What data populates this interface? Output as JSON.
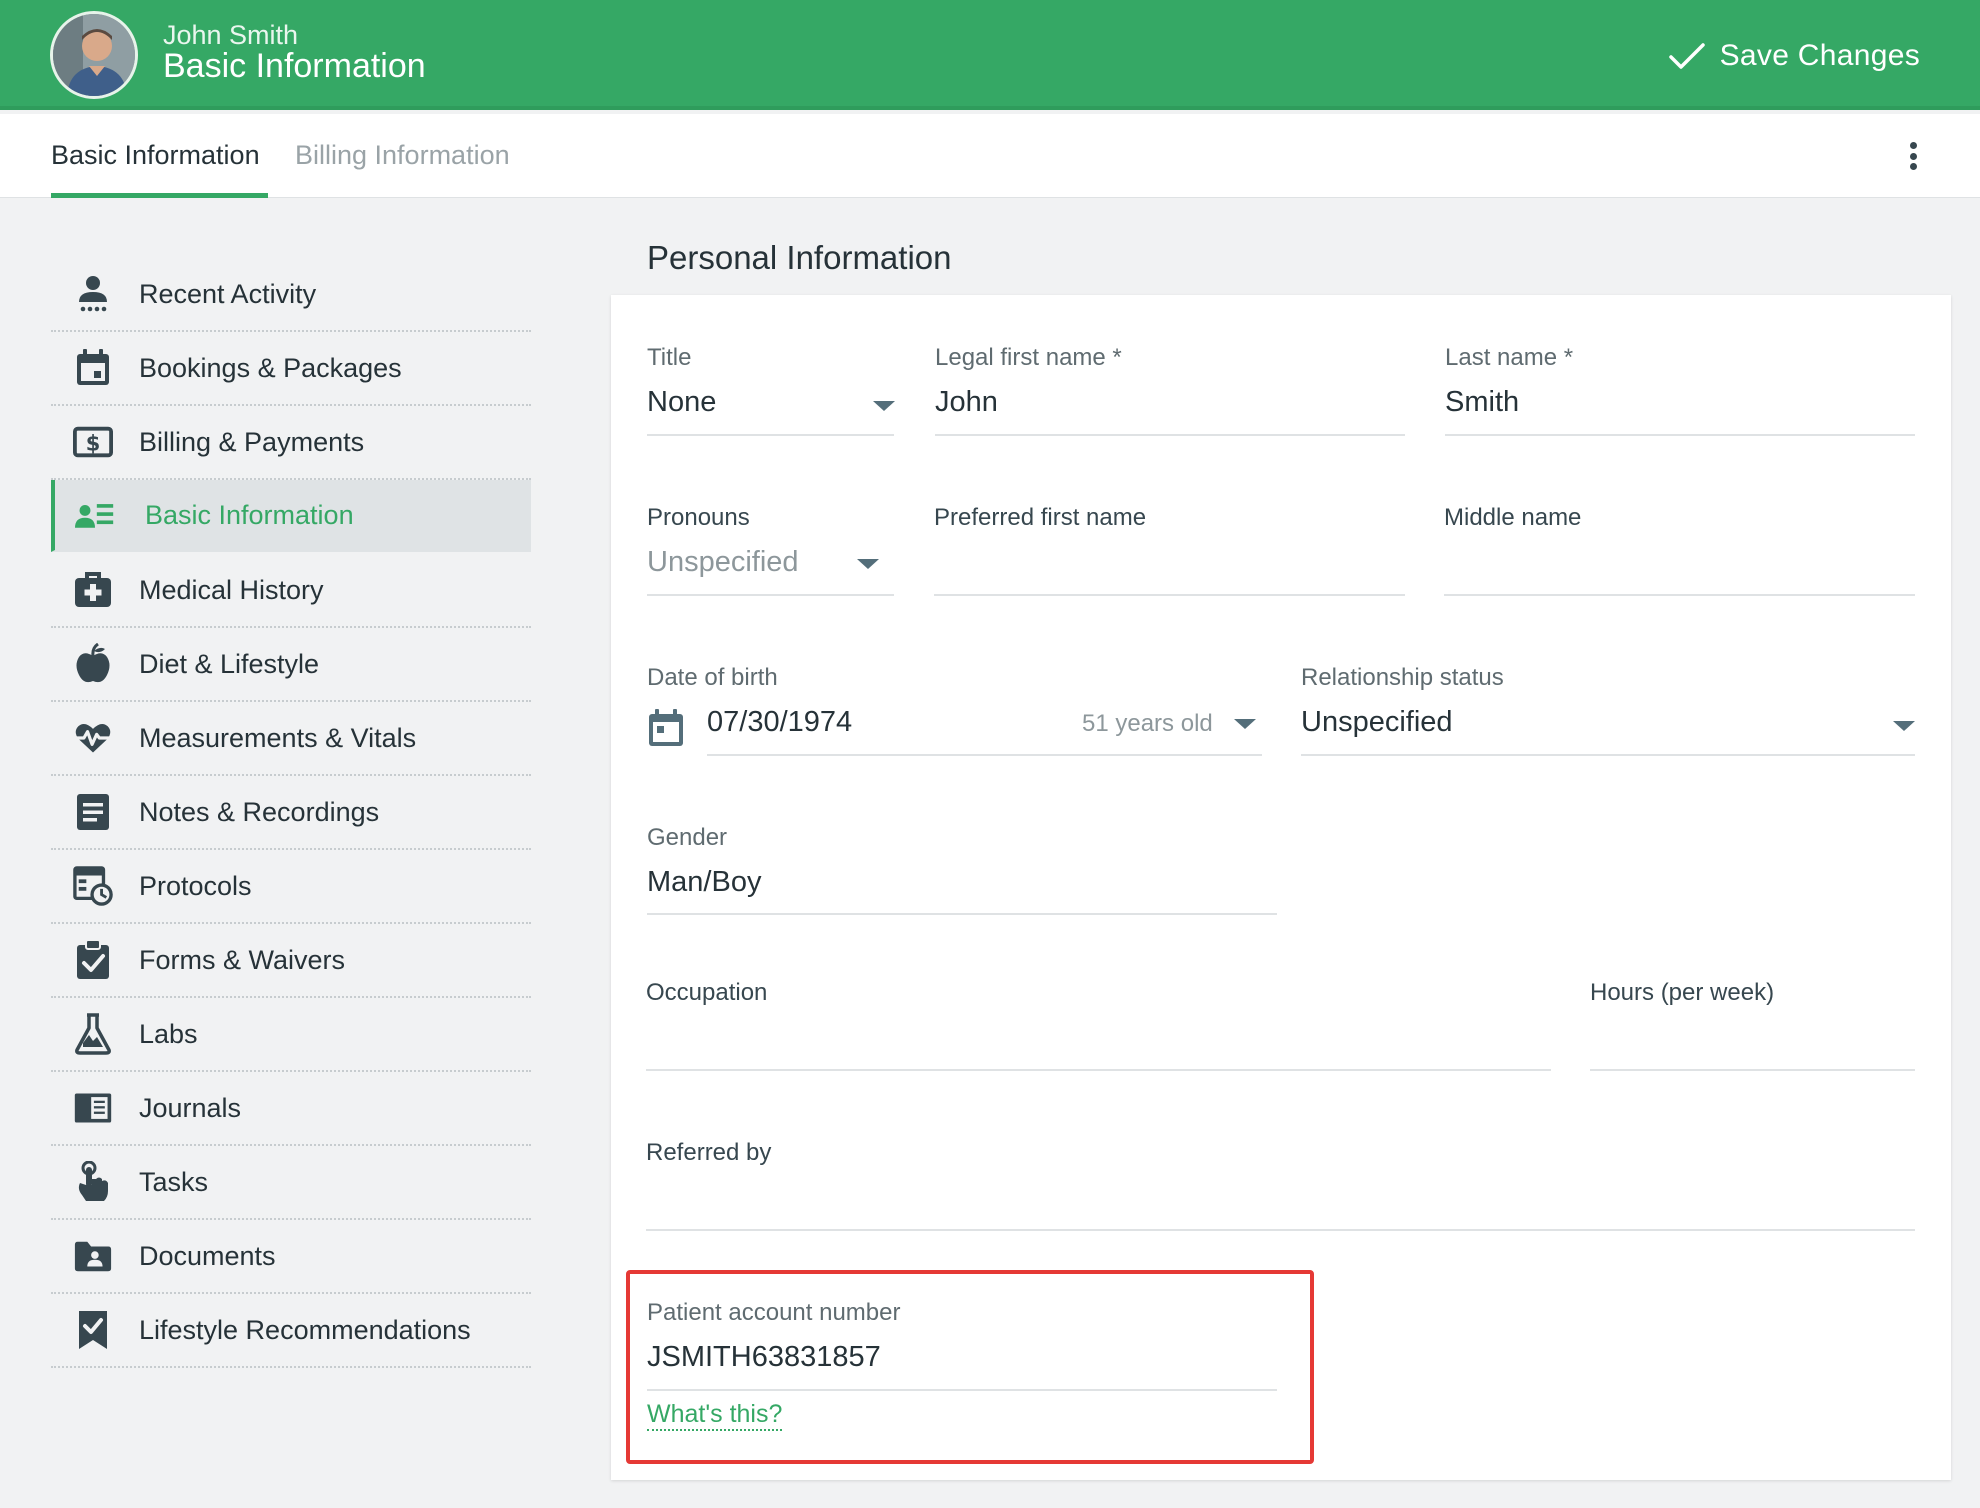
{
  "header": {
    "patient_name": "John Smith",
    "page_title": "Basic Information",
    "save_label": "Save Changes"
  },
  "tabs": [
    {
      "label": "Basic Information",
      "active": true
    },
    {
      "label": "Billing Information",
      "active": false
    }
  ],
  "sidebar": {
    "items": [
      {
        "label": "Recent Activity",
        "icon": "person-activity-icon"
      },
      {
        "label": "Bookings & Packages",
        "icon": "calendar-icon"
      },
      {
        "label": "Billing & Payments",
        "icon": "dollar-bill-icon"
      },
      {
        "label": "Basic Information",
        "icon": "contact-card-icon",
        "active": true
      },
      {
        "label": "Medical History",
        "icon": "medical-kit-icon"
      },
      {
        "label": "Diet & Lifestyle",
        "icon": "apple-icon"
      },
      {
        "label": "Measurements & Vitals",
        "icon": "heartbeat-icon"
      },
      {
        "label": "Notes & Recordings",
        "icon": "note-icon"
      },
      {
        "label": "Protocols",
        "icon": "protocol-clock-icon"
      },
      {
        "label": "Forms & Waivers",
        "icon": "clipboard-check-icon"
      },
      {
        "label": "Labs",
        "icon": "flask-icon"
      },
      {
        "label": "Journals",
        "icon": "journal-icon"
      },
      {
        "label": "Tasks",
        "icon": "hand-pointer-icon"
      },
      {
        "label": "Documents",
        "icon": "folder-person-icon"
      },
      {
        "label": "Lifestyle Recommendations",
        "icon": "bookmark-check-icon"
      }
    ]
  },
  "section": {
    "title": "Personal Information"
  },
  "form": {
    "title": {
      "label": "Title",
      "value": "None"
    },
    "legal_first_name": {
      "label": "Legal first name *",
      "value": "John"
    },
    "last_name": {
      "label": "Last name *",
      "value": "Smith"
    },
    "pronouns": {
      "label": "Pronouns",
      "value": "Unspecified"
    },
    "preferred_first_name": {
      "label": "Preferred first name",
      "value": ""
    },
    "middle_name": {
      "label": "Middle name",
      "value": ""
    },
    "date_of_birth": {
      "label": "Date of birth",
      "value": "07/30/1974",
      "age": "51 years old"
    },
    "relationship_status": {
      "label": "Relationship status",
      "value": "Unspecified"
    },
    "gender": {
      "label": "Gender",
      "value": "Man/Boy"
    },
    "occupation": {
      "label": "Occupation",
      "value": ""
    },
    "hours": {
      "label": "Hours (per week)",
      "value": ""
    },
    "referred_by": {
      "label": "Referred by",
      "value": ""
    },
    "account_number": {
      "label": "Patient account number",
      "value": "JSMITH63831857",
      "help_link": "What's this?"
    }
  },
  "colors": {
    "brand_green": "#35a865",
    "highlight_red": "#e53935",
    "text_dark": "#263238"
  }
}
